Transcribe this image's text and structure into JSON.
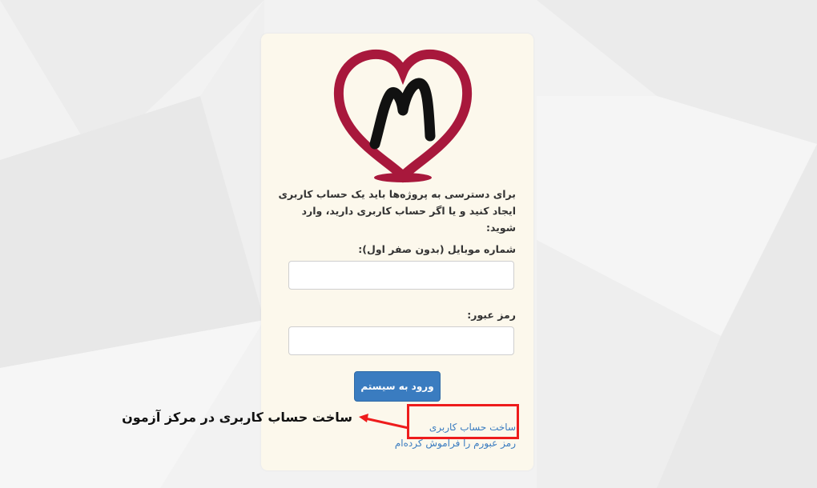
{
  "form": {
    "intro": "برای دسترسی به پروژه‌ها باید یک حساب کاربری ایجاد کنید و یا اگر حساب کاربری دارید، وارد شوید:",
    "mobile_label": "شماره موبایل (بدون صفر اول):",
    "mobile_value": "",
    "password_label": "رمز عبور:",
    "password_value": "",
    "login_button": "ورود به سیستم",
    "create_account_link": "ساخت حساب کاربری",
    "forgot_password_link": "رمز عبورم را فراموش کرده‌ام"
  },
  "annotation": {
    "text": "ساخت حساب کاربری در مرکز آزمون",
    "box_color": "#ee1c1c"
  },
  "logo": {
    "icon": "heart-m-logo",
    "color": "#a8183c"
  }
}
